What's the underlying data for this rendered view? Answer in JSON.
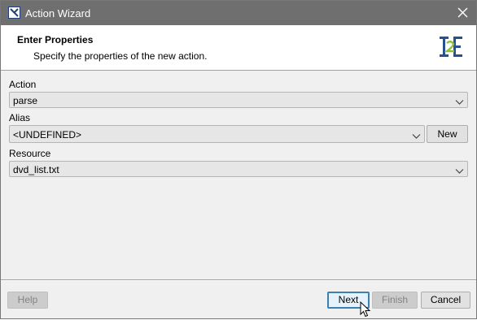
{
  "window": {
    "title": "Action Wizard",
    "icon": "app-icon",
    "close_icon": "close-icon"
  },
  "header": {
    "title": "Enter Properties",
    "description": "Specify the properties of the  new action.",
    "logo_icon": "wizard-logo-icon"
  },
  "form": {
    "action": {
      "label": "Action",
      "value": "parse"
    },
    "alias": {
      "label": "Alias",
      "value": "<UNDEFINED>",
      "new_button": "New"
    },
    "resource": {
      "label": "Resource",
      "value": "dvd_list.txt"
    }
  },
  "footer": {
    "help": "Help",
    "next": "Next",
    "finish": "Finish",
    "cancel": "Cancel"
  },
  "colors": {
    "titlebar": "#6f6f6f",
    "focus_border": "#3c7fb1",
    "logo_blue": "#27508f",
    "logo_green": "#8dbf3f"
  }
}
